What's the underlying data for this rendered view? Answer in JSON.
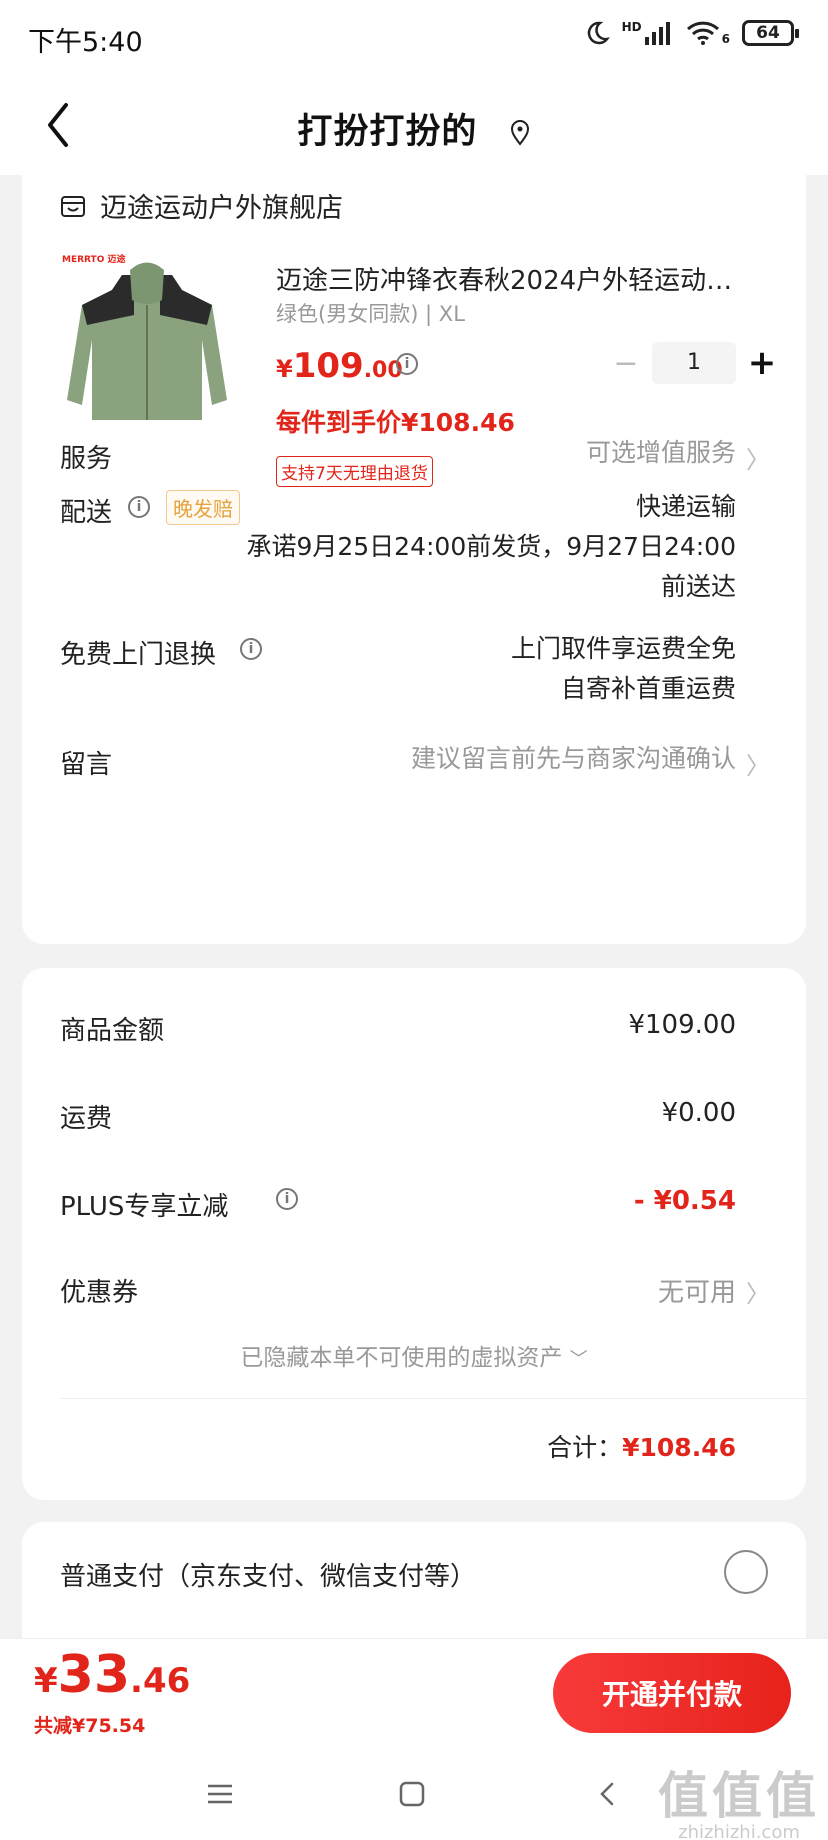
{
  "status": {
    "time": "下午5:40",
    "network": "HD",
    "wifi": "6",
    "battery": "64"
  },
  "header": {
    "title": "打扮打扮的"
  },
  "store": {
    "name": "迈途运动户外旗舰店"
  },
  "product": {
    "brand_logo": "MERRTO 迈途",
    "title": "迈途三防冲锋衣春秋2024户外轻运动…",
    "spec": "绿色(男女同款) | XL",
    "price_currency": "¥",
    "price_int": "109",
    "price_dec": ".00",
    "final_price": "每件到手价¥108.46",
    "return_tag": "支持7天无理由退货",
    "quantity": "1",
    "minus": "−",
    "plus": "+"
  },
  "rows": {
    "service_label": "服务",
    "service_value": "可选增值服务",
    "delivery_label": "配送",
    "delivery_tag": "晚发赔",
    "delivery_method": "快递运输",
    "delivery_promise_1": "承诺9月25日24:00前发货，9月27日24:00",
    "delivery_promise_2": "前送达",
    "free_return_label": "免费上门退换",
    "free_return_1": "上门取件享运费全免",
    "free_return_2": "自寄补首重运费",
    "message_label": "留言",
    "message_placeholder": "建议留言前先与商家沟通确认"
  },
  "summary": {
    "goods_label": "商品金额",
    "goods_value": "¥109.00",
    "shipping_label": "运费",
    "shipping_value": "¥0.00",
    "plus_label": "PLUS专享立减",
    "plus_value": "- ¥0.54",
    "coupon_label": "优惠券",
    "coupon_value": "无可用",
    "hidden_assets": "已隐藏本单不可使用的虚拟资产",
    "total_label": "合计：",
    "total_value": "¥108.46"
  },
  "payment": {
    "method_label": "普通支付（京东支付、微信支付等）"
  },
  "bottom": {
    "pay_currency": "¥",
    "pay_int": "33",
    "pay_dec": ".46",
    "saved": "共减¥75.54",
    "button": "开通并付款"
  },
  "watermark": {
    "big": "值值值",
    "small": "zhizhizhi.com"
  },
  "colors": {
    "accent_red": "#e1251b",
    "tag_orange": "#e6a23c",
    "background": "#f2f2f2"
  }
}
